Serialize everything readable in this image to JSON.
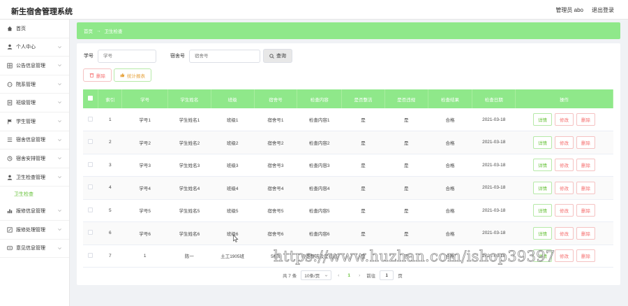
{
  "header": {
    "app_title": "新生宿舍管理系统",
    "user_label": "管理员 abo",
    "logout_label": "退出登录"
  },
  "sidebar": {
    "items": [
      {
        "label": "首页",
        "icon": "home-icon",
        "has_children": false
      },
      {
        "label": "个人中心",
        "icon": "user-icon",
        "has_children": true
      },
      {
        "label": "公告信息管理",
        "icon": "grid-icon",
        "has_children": true
      },
      {
        "label": "院系管理",
        "icon": "chat-icon",
        "has_children": true
      },
      {
        "label": "班级管理",
        "icon": "doc-icon",
        "has_children": true
      },
      {
        "label": "学生管理",
        "icon": "flag-icon",
        "has_children": true
      },
      {
        "label": "宿舍信息管理",
        "icon": "list-icon",
        "has_children": true
      },
      {
        "label": "宿舍安排管理",
        "icon": "clock-icon",
        "has_children": true
      },
      {
        "label": "卫生检查管理",
        "icon": "user-icon",
        "has_children": true
      },
      {
        "label": "报修信息管理",
        "icon": "chart-icon",
        "has_children": true
      },
      {
        "label": "报修处理管理",
        "icon": "edit-icon",
        "has_children": true
      },
      {
        "label": "意见信息管理",
        "icon": "card-icon",
        "has_children": true
      }
    ],
    "active_sub": "卫生检查"
  },
  "breadcrumb": {
    "home": "首页",
    "separator": "→",
    "current": "卫生检查"
  },
  "search": {
    "student_id_label": "学号",
    "student_id_placeholder": "学号",
    "dorm_label": "宿舍号",
    "dorm_placeholder": "宿舍号",
    "query_label": "查询"
  },
  "actions": {
    "delete_label": "删除",
    "report_label": "统计报表"
  },
  "table": {
    "headers": [
      "索引",
      "学号",
      "学生姓名",
      "班级",
      "宿舍号",
      "检查内容",
      "是否整洁",
      "是否违规",
      "检查结果",
      "检查日期",
      "操作"
    ],
    "rows": [
      [
        "1",
        "学号1",
        "学生姓名1",
        "班级1",
        "宿舍号1",
        "检查内容1",
        "是",
        "是",
        "合格",
        "2021-03-18"
      ],
      [
        "2",
        "学号2",
        "学生姓名2",
        "班级2",
        "宿舍号2",
        "检查内容2",
        "是",
        "是",
        "合格",
        "2021-03-18"
      ],
      [
        "3",
        "学号3",
        "学生姓名3",
        "班级3",
        "宿舍号3",
        "检查内容3",
        "是",
        "是",
        "合格",
        "2021-03-18"
      ],
      [
        "4",
        "学号4",
        "学生姓名4",
        "班级4",
        "宿舍号4",
        "检查内容4",
        "是",
        "是",
        "合格",
        "2021-03-18"
      ],
      [
        "5",
        "学号5",
        "学生姓名5",
        "班级5",
        "宿舍号5",
        "检查内容5",
        "是",
        "是",
        "合格",
        "2021-03-18"
      ],
      [
        "6",
        "学号6",
        "学生姓名6",
        "班级6",
        "宿舍号6",
        "检查内容6",
        "是",
        "是",
        "合格",
        "2021-03-18"
      ],
      [
        "7",
        "1",
        "陈一",
        "土工1905班",
        "5栋6",
        "检查整洁及是否违",
        "是",
        "否",
        "合格",
        "2021-03-18"
      ]
    ],
    "op_detail": "详情",
    "op_edit": "修改",
    "op_delete": "删除"
  },
  "pager": {
    "total": "共 7 条",
    "page_size": "10条/页",
    "current_page": "1",
    "goto_label": "前往",
    "goto_value": "1",
    "page_suffix": "页"
  },
  "watermark": "https://www.huzhan.com/ishop39397",
  "colors": {
    "accent_green": "#8fe88a",
    "text_green": "#67c23a",
    "danger": "#f56c6c",
    "warning": "#e6a23c"
  }
}
